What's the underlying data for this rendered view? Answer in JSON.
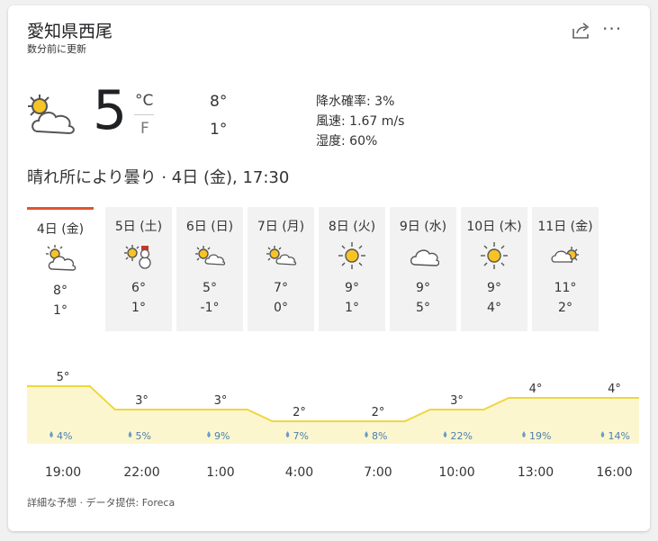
{
  "header": {
    "location": "愛知県西尾",
    "updated": "数分前に更新",
    "more": "···"
  },
  "current": {
    "icon": "partly-sunny-icon",
    "temp": "5",
    "unit_c": "°C",
    "unit_f": "F",
    "high": "8°",
    "low": "1°",
    "precip": "降水確率: 3%",
    "wind": "風速: 1.67 m/s",
    "humidity": "湿度: 60%",
    "condition": "晴れ所により曇り · 4日 (金), 17:30"
  },
  "days": [
    {
      "name": "4日 (金)",
      "icon": "partly-sunny-icon",
      "high": "8°",
      "low": "1°",
      "selected": true
    },
    {
      "name": "5日 (土)",
      "icon": "sun-snow-icon",
      "high": "6°",
      "low": "1°"
    },
    {
      "name": "6日 (日)",
      "icon": "sun-cloud-icon",
      "high": "5°",
      "low": "-1°"
    },
    {
      "name": "7日 (月)",
      "icon": "sun-cloud-icon",
      "high": "7°",
      "low": "0°"
    },
    {
      "name": "8日 (火)",
      "icon": "sun-icon",
      "high": "9°",
      "low": "1°"
    },
    {
      "name": "9日 (水)",
      "icon": "cloud-icon",
      "high": "9°",
      "low": "5°"
    },
    {
      "name": "10日 (木)",
      "icon": "sun-icon",
      "high": "9°",
      "low": "4°"
    },
    {
      "name": "11日 (金)",
      "icon": "cloud-sun-icon",
      "high": "11°",
      "low": "2°"
    }
  ],
  "hourly": [
    {
      "time": "19:00",
      "temp": "5°",
      "precip": "4%"
    },
    {
      "time": "22:00",
      "temp": "3°",
      "precip": "5%"
    },
    {
      "time": "1:00",
      "temp": "3°",
      "precip": "9%"
    },
    {
      "time": "4:00",
      "temp": "2°",
      "precip": "7%"
    },
    {
      "time": "7:00",
      "temp": "2°",
      "precip": "8%"
    },
    {
      "time": "10:00",
      "temp": "3°",
      "precip": "22%"
    },
    {
      "time": "13:00",
      "temp": "4°",
      "precip": "19%"
    },
    {
      "time": "16:00",
      "temp": "4°",
      "precip": "14%"
    }
  ],
  "chart_data": {
    "type": "area",
    "x": [
      "19:00",
      "22:00",
      "1:00",
      "4:00",
      "7:00",
      "10:00",
      "13:00",
      "16:00"
    ],
    "series": [
      {
        "values": [
          5,
          3,
          3,
          2,
          2,
          3,
          4,
          4
        ]
      }
    ],
    "precipitation": [
      "4%",
      "5%",
      "9%",
      "7%",
      "8%",
      "22%",
      "19%",
      "14%"
    ],
    "colors": {
      "line": "#f0d640",
      "fill": "#fcf6cf",
      "drop": "#6a9cc8"
    }
  },
  "footer": "詳細な予想 · データ提供: Foreca"
}
